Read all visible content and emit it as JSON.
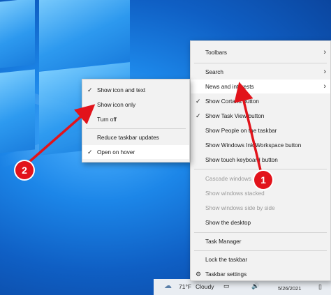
{
  "context_menu": {
    "items": [
      {
        "label": "Toolbars"
      },
      {
        "label": "Search"
      },
      {
        "label": "News and interests"
      },
      {
        "label": "Show Cortana button"
      },
      {
        "label": "Show Task View button"
      },
      {
        "label": "Show People on the taskbar"
      },
      {
        "label": "Show Windows Ink Workspace button"
      },
      {
        "label": "Show touch keyboard button"
      },
      {
        "label": "Cascade windows"
      },
      {
        "label": "Show windows stacked"
      },
      {
        "label": "Show windows side by side"
      },
      {
        "label": "Show the desktop"
      },
      {
        "label": "Task Manager"
      },
      {
        "label": "Lock the taskbar"
      },
      {
        "label": "Taskbar settings"
      }
    ]
  },
  "submenu": {
    "items": [
      {
        "label": "Show icon and text",
        "checked": true
      },
      {
        "label": "Show icon only",
        "checked": false
      },
      {
        "label": "Turn off",
        "checked": false
      },
      {
        "label": "Reduce taskbar updates",
        "checked": false
      },
      {
        "label": "Open on hover",
        "checked": true
      }
    ]
  },
  "taskbar": {
    "weather_temp": "71°F",
    "weather_text": "Cloudy",
    "date": "5/26/2021"
  },
  "annotations": {
    "step_1": "1",
    "step_2": "2"
  },
  "icons": {
    "check": "checkmark-icon",
    "chevron": "chevron-right-icon",
    "gear": "gear-icon",
    "cloud": "cloud-icon"
  },
  "colors": {
    "annotation_red": "#e2131b",
    "menu_bg": "#f2f2f2",
    "desktop_blue": "#1671d6"
  }
}
